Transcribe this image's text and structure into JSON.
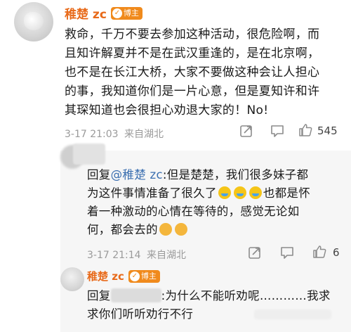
{
  "top_comment": {
    "username": "稚楚 zc",
    "badge": "博主",
    "lines": [
      "救命，千万不要去参加这种活动，很危险啊，而",
      "且知许解夏并不是在武汉重逢的，是在北京啊，",
      "也不是在长江大桥，大家不要做这种会让人担心",
      "的事，我知道你们是一片心意，但是夏知许和许",
      "其琛知道也会很担心劝退大家的！No!"
    ],
    "timestamp": "3-17 21:03",
    "location": "来自湖北",
    "like_count": "545"
  },
  "reply_1": {
    "prefix": "回复",
    "mention": "@稚楚 zc",
    "line1_rest": ":但是楚楚，我们很多妹子都",
    "line2_before": "为这件事情准备了很久了",
    "line2_after": "也都是怀",
    "line3": "着一种激动的心情在等待的，感觉无论如",
    "line4": "何，都会去的",
    "timestamp": "3-17 21:14",
    "location": "来自湖北",
    "like_count": "6"
  },
  "reply_2": {
    "username": "稚楚 zc",
    "badge": "博主",
    "prefix": "回复",
    "line1_rest": ":为什么不能听劝呢…………我求",
    "line2": "求你们听听劝行不行"
  },
  "icons": {
    "share": "share-icon",
    "comment": "comment-icon",
    "like": "thumbs-up-icon"
  }
}
